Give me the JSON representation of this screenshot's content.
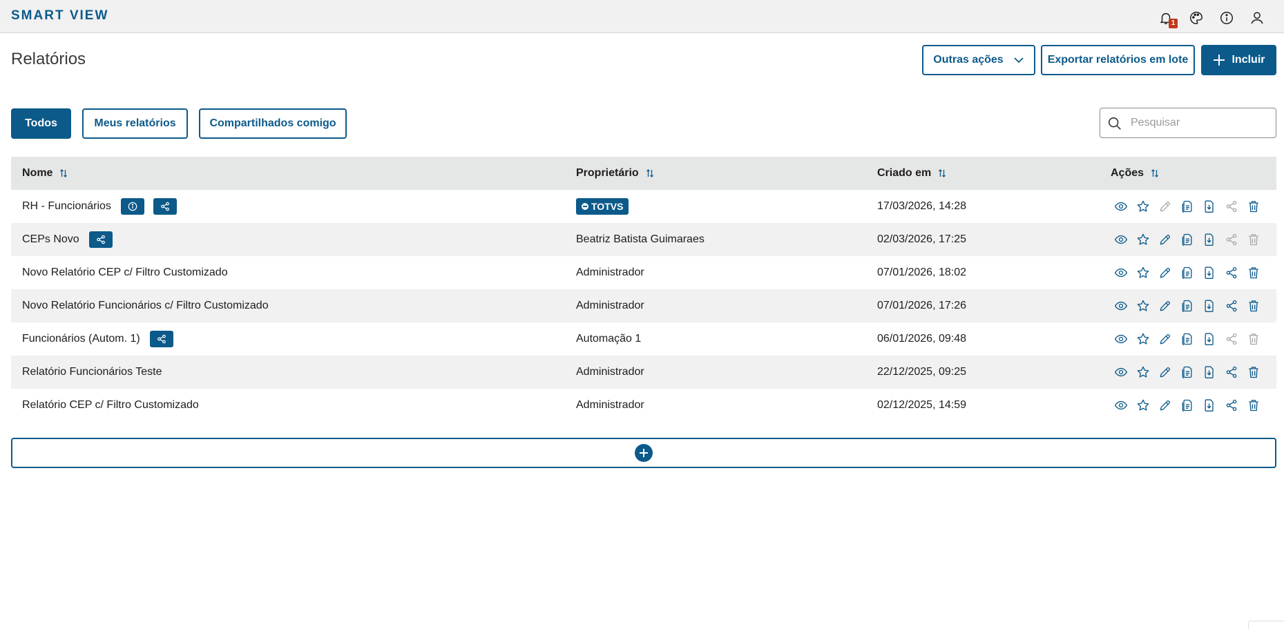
{
  "app": {
    "brand": "SMART VIEW",
    "notification_count": "1"
  },
  "page": {
    "title": "Relatórios"
  },
  "header_actions": {
    "other_actions_label": "Outras ações",
    "export_label": "Exportar relatórios em lote",
    "include_label": "Incluir"
  },
  "filters": {
    "all_label": "Todos",
    "mine_label": "Meus relatórios",
    "shared_label": "Compartilhados comigo",
    "active": "Todos"
  },
  "search": {
    "placeholder": "Pesquisar",
    "value": ""
  },
  "table": {
    "columns": {
      "name": "Nome",
      "owner": "Proprietário",
      "created": "Criado em",
      "actions": "Ações"
    },
    "rows": [
      {
        "name": "RH - Funcionários",
        "owner": "TOTVS",
        "created": "17/03/2026, 14:28",
        "has_info": true,
        "has_share_tag": true,
        "owner_is_badge": true,
        "edit_enabled": false,
        "share_enabled": false,
        "delete_enabled": true
      },
      {
        "name": "CEPs Novo",
        "owner": "Beatriz Batista Guimaraes",
        "created": "02/03/2026, 17:25",
        "has_info": false,
        "has_share_tag": true,
        "owner_is_badge": false,
        "edit_enabled": true,
        "share_enabled": false,
        "delete_enabled": false
      },
      {
        "name": "Novo Relatório CEP c/ Filtro Customizado",
        "owner": "Administrador",
        "created": "07/01/2026, 18:02",
        "has_info": false,
        "has_share_tag": false,
        "owner_is_badge": false,
        "edit_enabled": true,
        "share_enabled": true,
        "delete_enabled": true
      },
      {
        "name": "Novo Relatório Funcionários c/ Filtro Customizado",
        "owner": "Administrador",
        "created": "07/01/2026, 17:26",
        "has_info": false,
        "has_share_tag": false,
        "owner_is_badge": false,
        "edit_enabled": true,
        "share_enabled": true,
        "delete_enabled": true
      },
      {
        "name": "Funcionários (Autom. 1)",
        "owner": "Automação 1",
        "created": "06/01/2026, 09:48",
        "has_info": false,
        "has_share_tag": true,
        "owner_is_badge": false,
        "edit_enabled": true,
        "share_enabled": false,
        "delete_enabled": false
      },
      {
        "name": "Relatório Funcionários Teste",
        "owner": "Administrador",
        "created": "22/12/2025, 09:25",
        "has_info": false,
        "has_share_tag": false,
        "owner_is_badge": false,
        "edit_enabled": true,
        "share_enabled": true,
        "delete_enabled": true
      },
      {
        "name": "Relatório CEP c/ Filtro Customizado",
        "owner": "Administrador",
        "created": "02/12/2025, 14:59",
        "has_info": false,
        "has_share_tag": false,
        "owner_is_badge": false,
        "edit_enabled": true,
        "share_enabled": true,
        "delete_enabled": true
      }
    ]
  },
  "row_actions": [
    "eye-icon",
    "star-icon",
    "pencil-icon",
    "copy-icon",
    "download-icon",
    "share-icon",
    "trash-icon"
  ],
  "colors": {
    "primary": "#0c5a8a",
    "badge_red": "#c0391b",
    "disabled": "#a8a8a8"
  }
}
